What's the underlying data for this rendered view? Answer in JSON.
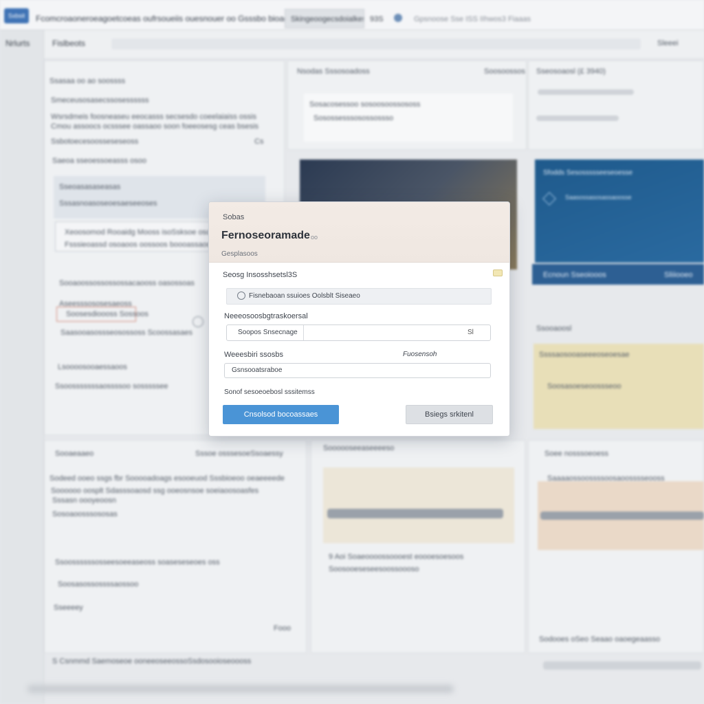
{
  "topbar": {
    "badge": "Sxbsit",
    "title": "Fcomcroaoneroeagoetcoeas oufrsoueiis ouesnouer oo    Gsssbo bioags",
    "tab": "Skingeoogecsdoialkes",
    "count": "93S",
    "status": "Gpsnoose  Sse  ISS  IIhwos3  Fiaaas"
  },
  "subbar": {
    "left_label": "Nrlurts",
    "tab_label": "Fislbeots",
    "right_label": "Sleeei"
  },
  "background": {
    "left_panel": {
      "heading": "Ssasaa oo ao soossss",
      "line1": "Smeceusosasecssosessssss",
      "para1": "Wsrsdmeis foosneaseu eeocasss secsesdo coeelaiaiss ossis",
      "para2": "Cmou assoocs ocsssee oassaoo soon foeeosesg ceas bsesis",
      "meta": "Ssbotoecesoosseseseoss",
      "meta_right": "Cs",
      "section": "Saeoa sseoessoeasss osoo",
      "card_line1": "Sseoasasaseasas",
      "card_line2": "Sssasnoasoseoesaeseeoses",
      "highlight1": "Xeoosomod Rooaidg Mooss  isoSsksoe osc",
      "highlight2": "Fsssieoassd osoaoos oossoos boooassaoogoe",
      "list_title": "Sooaoossossossossacaooss oasossoas",
      "list_item1": "Aseesssososesaeoss",
      "list_item2": "Soosesdioooss Sossoos",
      "list_item3": "Saasooasossseosossoss Scoossasaes",
      "list_item4": "Lsoooosooaessaoos",
      "list_item5": "Ssoosssssssaossssoo sosssssee"
    },
    "middle_panel": {
      "heading": "Nsodas  Sssosoadoss",
      "heading_right": "Soosoossos",
      "card_line1": "Sosacosessoo sosoosoossososs",
      "card_line2": "Sosossesssosossossso"
    },
    "right_panel": {
      "heading": "Sseosoaosl (£ 3940)",
      "blue_card_title": "Sfodds  Sesossssseeseoesse",
      "blue_card_line": "Saasossasosassaoosse",
      "blue_button": "Ecnoun Sseoiooos",
      "blue_button_right": "Sliiiooeo",
      "section2": "Ssooaoosl",
      "yellow_line1": "Ssssaosooaseeeoseoesae",
      "yellow_line2": "Soosasoeseoossseoo"
    },
    "bottom": {
      "left_tab": "Sooaeaaeo",
      "left_tab_right": "Sssoe osssesoeSsoaessy",
      "para1": "Sodeed ooeo ssgs fbr Sooooadoags esooeuod Sssbioeoo oeaeeeede",
      "para2": "Soooooo   oosplt Sdasssoaosd ssg ooeosnsoe soeiaoosoasfes",
      "para3": "Sssasn  oooyeoosn",
      "para4": "Sosoaoosssososas",
      "middle_title": "Soooooseeaseeeeso",
      "middle_line1": "9 Aoi Soaeoooossoooest eoooesoesoos",
      "middle_line2": "Soosooeseseesoossoooso",
      "right_title": "Soee nosssoeoess",
      "right_line1": "Saaaaossoossssoosaoosssseooss",
      "list_row1": "Ssoossssssosseesoeeaseoss   soaseseseoes  oss",
      "list_row2": "Soosasossossssaossoo",
      "list_row3": "Sseeeey",
      "list_row3_right": "Fooo",
      "footer_left": "S Csnmmd Saemoseoe ooneeoseeossoSsdosooioseoooss",
      "footer_right": "Sodooes  oSeo Seaao  oaoegeaasso"
    }
  },
  "modal": {
    "eyebrow": "Sobas",
    "title": "Fernoseoramade",
    "title_extra": "oo",
    "subtitle": "Gesplasoos",
    "section_label": "Seosg Insosshsetsl3S",
    "notice": "Fisnebaoan ssuioes Oolsblt Siseaeo",
    "field1_label": "Neeeosoosbgtraskoersal",
    "field1_prefix": "Soopos Snsecnage",
    "field1_icon": "Sl",
    "field2_label": "Weeesbiri ssosbs",
    "field2_right": "Fuosensoh",
    "field2_value": "Gsnsooatsraboe",
    "field3_label": "Sonof sesoeoebosl sssitemss",
    "primary_button": "Cnsolsod bocoassaes",
    "secondary_button": "Bsiegs srkitenl"
  },
  "colors": {
    "primary_button": "#4a94d6",
    "brand_badge": "#3f73b5",
    "blue_card": "#1f5a8c",
    "modal_header": "#f3ebe5"
  }
}
